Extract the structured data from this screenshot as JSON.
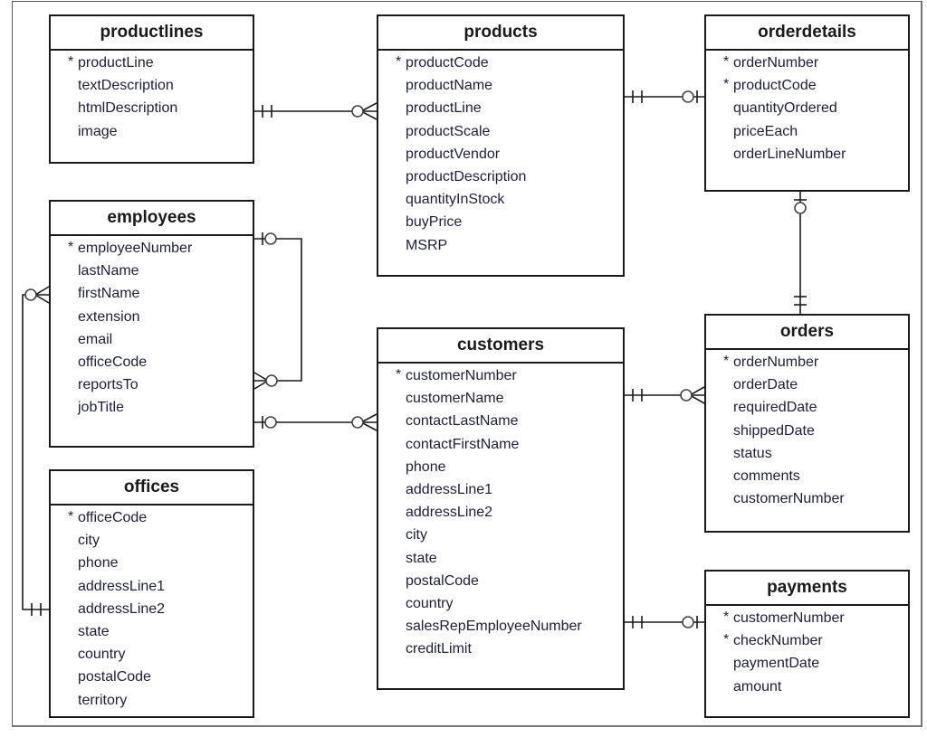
{
  "diagram": {
    "type": "entity-relationship",
    "entities": {
      "productlines": {
        "title": "productlines",
        "attributes": [
          {
            "name": "productLine",
            "pk": true
          },
          {
            "name": "textDescription",
            "pk": false
          },
          {
            "name": "htmlDescription",
            "pk": false
          },
          {
            "name": "image",
            "pk": false
          }
        ]
      },
      "products": {
        "title": "products",
        "attributes": [
          {
            "name": "productCode",
            "pk": true
          },
          {
            "name": "productName",
            "pk": false
          },
          {
            "name": "productLine",
            "pk": false
          },
          {
            "name": "productScale",
            "pk": false
          },
          {
            "name": "productVendor",
            "pk": false
          },
          {
            "name": "productDescription",
            "pk": false
          },
          {
            "name": "quantityInStock",
            "pk": false
          },
          {
            "name": "buyPrice",
            "pk": false
          },
          {
            "name": "MSRP",
            "pk": false
          }
        ]
      },
      "orderdetails": {
        "title": "orderdetails",
        "attributes": [
          {
            "name": "orderNumber",
            "pk": true
          },
          {
            "name": "productCode",
            "pk": true
          },
          {
            "name": "quantityOrdered",
            "pk": false
          },
          {
            "name": "priceEach",
            "pk": false
          },
          {
            "name": "orderLineNumber",
            "pk": false
          }
        ]
      },
      "employees": {
        "title": "employees",
        "attributes": [
          {
            "name": "employeeNumber",
            "pk": true
          },
          {
            "name": "lastName",
            "pk": false
          },
          {
            "name": "firstName",
            "pk": false
          },
          {
            "name": "extension",
            "pk": false
          },
          {
            "name": "email",
            "pk": false
          },
          {
            "name": "officeCode",
            "pk": false
          },
          {
            "name": "reportsTo",
            "pk": false
          },
          {
            "name": "jobTitle",
            "pk": false
          }
        ]
      },
      "offices": {
        "title": "offices",
        "attributes": [
          {
            "name": "officeCode",
            "pk": true
          },
          {
            "name": "city",
            "pk": false
          },
          {
            "name": "phone",
            "pk": false
          },
          {
            "name": "addressLine1",
            "pk": false
          },
          {
            "name": "addressLine2",
            "pk": false
          },
          {
            "name": "state",
            "pk": false
          },
          {
            "name": "country",
            "pk": false
          },
          {
            "name": "postalCode",
            "pk": false
          },
          {
            "name": "territory",
            "pk": false
          }
        ]
      },
      "customers": {
        "title": "customers",
        "attributes": [
          {
            "name": "customerNumber",
            "pk": true
          },
          {
            "name": "customerName",
            "pk": false
          },
          {
            "name": "contactLastName",
            "pk": false
          },
          {
            "name": "contactFirstName",
            "pk": false
          },
          {
            "name": "phone",
            "pk": false
          },
          {
            "name": "addressLine1",
            "pk": false
          },
          {
            "name": "addressLine2",
            "pk": false
          },
          {
            "name": "city",
            "pk": false
          },
          {
            "name": "state",
            "pk": false
          },
          {
            "name": "postalCode",
            "pk": false
          },
          {
            "name": "country",
            "pk": false
          },
          {
            "name": "salesRepEmployeeNumber",
            "pk": false
          },
          {
            "name": "creditLimit",
            "pk": false
          }
        ]
      },
      "orders": {
        "title": "orders",
        "attributes": [
          {
            "name": "orderNumber",
            "pk": true
          },
          {
            "name": "orderDate",
            "pk": false
          },
          {
            "name": "requiredDate",
            "pk": false
          },
          {
            "name": "shippedDate",
            "pk": false
          },
          {
            "name": "status",
            "pk": false
          },
          {
            "name": "comments",
            "pk": false
          },
          {
            "name": "customerNumber",
            "pk": false
          }
        ]
      },
      "payments": {
        "title": "payments",
        "attributes": [
          {
            "name": "customerNumber",
            "pk": true
          },
          {
            "name": "checkNumber",
            "pk": true
          },
          {
            "name": "paymentDate",
            "pk": false
          },
          {
            "name": "amount",
            "pk": false
          }
        ]
      }
    },
    "relationships": [
      {
        "from": "productlines",
        "from_card": "exactly-one",
        "to": "products",
        "to_card": "zero-or-many"
      },
      {
        "from": "products",
        "from_card": "exactly-one",
        "to": "orderdetails",
        "to_card": "zero-or-one"
      },
      {
        "from": "orders",
        "from_card": "exactly-one",
        "to": "orderdetails",
        "to_card": "zero-or-one"
      },
      {
        "from": "employees",
        "from_card": "zero-or-one",
        "to": "employees",
        "to_card": "zero-or-many",
        "note": "reportsTo self-reference"
      },
      {
        "from": "employees",
        "from_card": "zero-or-one",
        "to": "customers",
        "to_card": "zero-or-many"
      },
      {
        "from": "offices",
        "from_card": "exactly-one",
        "to": "employees",
        "to_card": "zero-or-many"
      },
      {
        "from": "customers",
        "from_card": "exactly-one",
        "to": "orders",
        "to_card": "zero-or-many"
      },
      {
        "from": "customers",
        "from_card": "exactly-one",
        "to": "payments",
        "to_card": "zero-or-one"
      }
    ]
  }
}
